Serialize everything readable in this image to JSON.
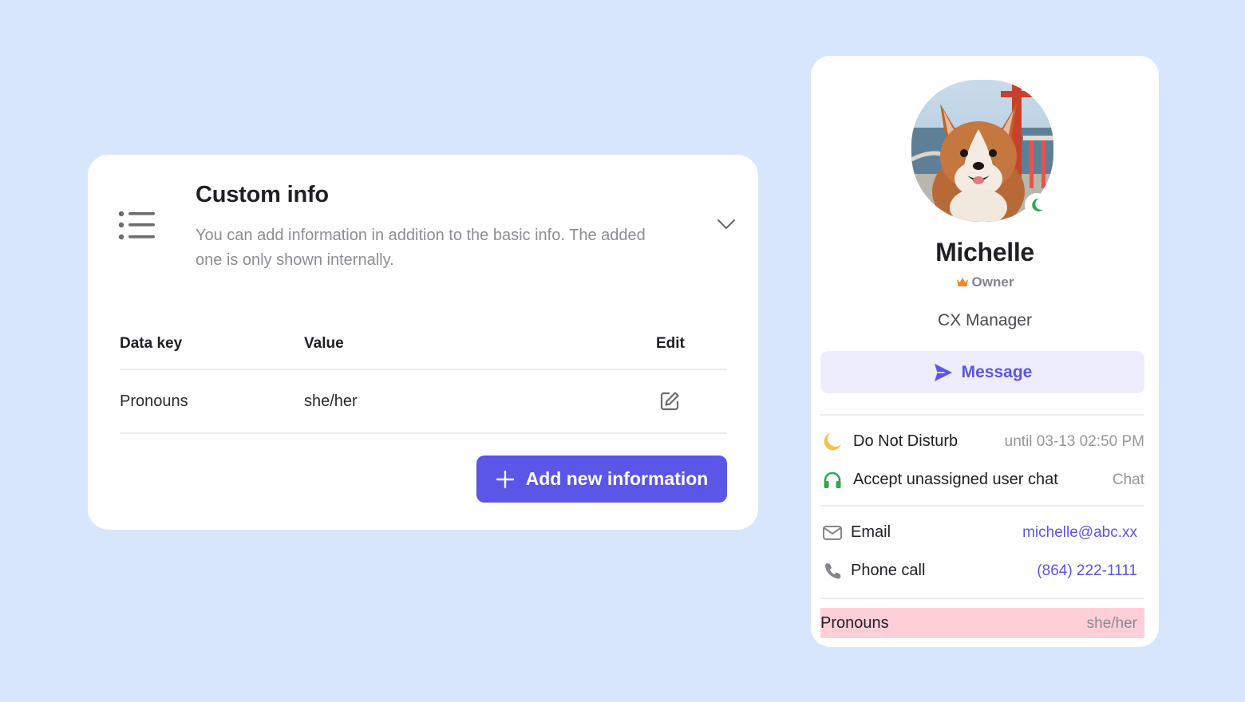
{
  "custom_info": {
    "title": "Custom info",
    "description": "You can add information in addition to the basic info. The added one is only shown internally.",
    "headers": {
      "key": "Data key",
      "value": "Value",
      "edit": "Edit"
    },
    "rows": [
      {
        "key": "Pronouns",
        "value": "she/her"
      }
    ],
    "add_button": "Add new information"
  },
  "profile": {
    "name": "Michelle",
    "role": "Owner",
    "job_title": "CX Manager",
    "message_button": "Message",
    "status": {
      "label": "Do Not Disturb",
      "value": "until 03-13 02:50 PM"
    },
    "chat": {
      "label": "Accept unassigned user chat",
      "value": "Chat"
    },
    "email": {
      "label": "Email",
      "value": "michelle@abc.xx"
    },
    "phone": {
      "label": "Phone call",
      "value": "(864) 222-1111"
    },
    "pronouns": {
      "label": "Pronouns",
      "value": "she/her"
    }
  },
  "colors": {
    "background": "#d8e6fd",
    "accent": "#5b55e8",
    "highlight": "#ffcfd8",
    "dnd_moon": "#f1c24b",
    "chat_green": "#2fa84f"
  }
}
